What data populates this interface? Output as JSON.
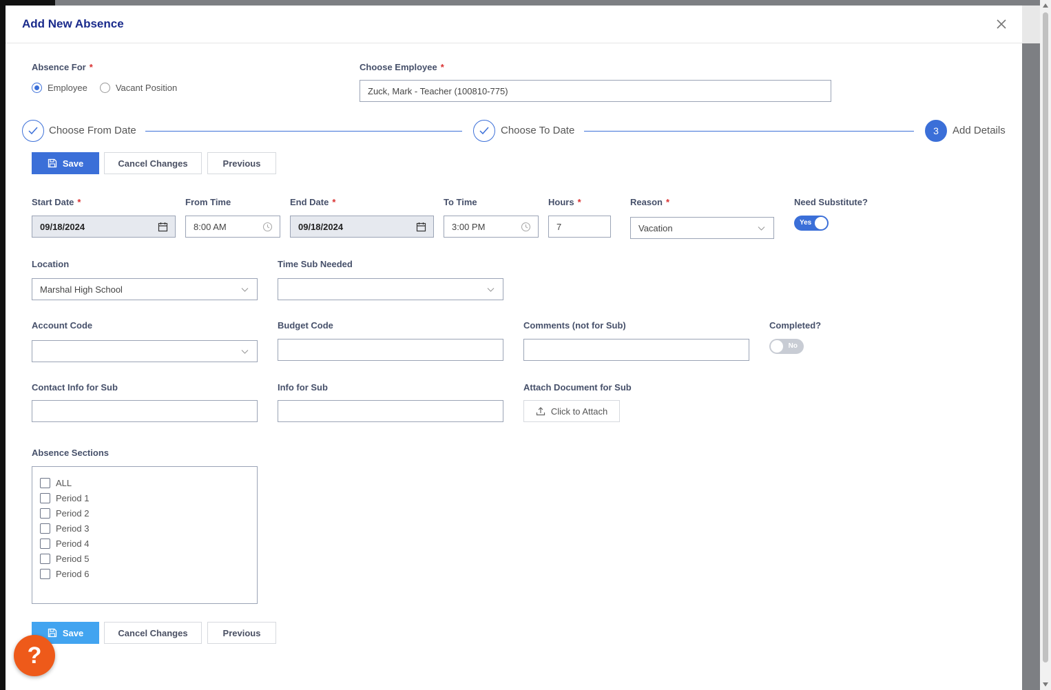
{
  "modal": {
    "title": "Add New Absence"
  },
  "absence_for": {
    "label": "Absence For",
    "options": [
      {
        "label": "Employee",
        "selected": true
      },
      {
        "label": "Vacant Position",
        "selected": false
      }
    ]
  },
  "employee": {
    "label": "Choose Employee",
    "value": "Zuck, Mark - Teacher (100810-775)"
  },
  "steps": [
    {
      "label": "Choose From Date",
      "status": "complete"
    },
    {
      "label": "Choose To Date",
      "status": "complete"
    },
    {
      "number": "3",
      "label": "Add Details",
      "status": "active"
    }
  ],
  "actions": {
    "save": "Save",
    "cancel": "Cancel Changes",
    "previous": "Previous"
  },
  "fields": {
    "start_date": {
      "label": "Start Date",
      "value": "09/18/2024"
    },
    "from_time": {
      "label": "From Time",
      "value": "8:00 AM"
    },
    "end_date": {
      "label": "End Date",
      "value": "09/18/2024"
    },
    "to_time": {
      "label": "To Time",
      "value": "3:00 PM"
    },
    "hours": {
      "label": "Hours",
      "value": "7"
    },
    "reason": {
      "label": "Reason",
      "value": "Vacation"
    },
    "need_substitute": {
      "label": "Need Substitute?",
      "value": "Yes"
    },
    "location": {
      "label": "Location",
      "value": "Marshal High School"
    },
    "time_sub_needed": {
      "label": "Time Sub Needed",
      "value": ""
    },
    "account_code": {
      "label": "Account Code",
      "value": ""
    },
    "budget_code": {
      "label": "Budget Code",
      "value": ""
    },
    "comments": {
      "label": "Comments (not for Sub)",
      "value": ""
    },
    "completed": {
      "label": "Completed?",
      "value": "No"
    },
    "contact_info": {
      "label": "Contact Info for Sub",
      "value": ""
    },
    "info_for_sub": {
      "label": "Info for Sub",
      "value": ""
    },
    "attach": {
      "label": "Attach Document for Sub",
      "button": "Click to Attach"
    }
  },
  "sections": {
    "label": "Absence Sections",
    "items": [
      "ALL",
      "Period 1",
      "Period 2",
      "Period 3",
      "Period 4",
      "Period 5",
      "Period 6"
    ]
  },
  "help": {
    "glyph": "?"
  },
  "colors": {
    "accent": "#3b6fd8",
    "title": "#1a2b8c",
    "required": "#d92f2f",
    "help": "#ee5a1a"
  }
}
